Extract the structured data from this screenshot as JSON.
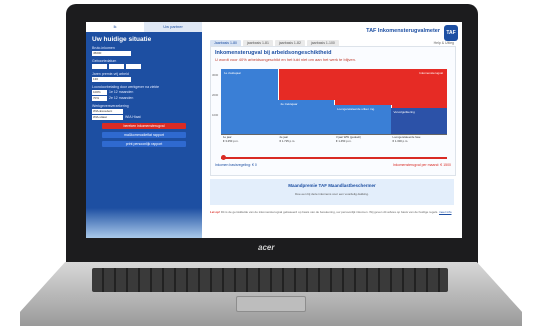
{
  "laptop": {
    "brand": "acer"
  },
  "left_panel": {
    "tabs": [
      "Ik",
      "Uw partner"
    ],
    "heading": "Uw huidige situatie",
    "fields": [
      {
        "label": "Bruto-inkomen",
        "value": "45000"
      },
      {
        "label": "Geboortedatum",
        "value": ""
      },
      {
        "label": "Jaren premie-vrij arbeid",
        "value": "130"
      },
      {
        "label": "Loondoorbetaling door werkgever na ziekte",
        "value": "100%"
      },
      {
        "label": "",
        "value": "70%"
      },
      {
        "label": "Werkgeversverzekering",
        "value": "WIA-Excedent"
      },
      {
        "label": "",
        "value": "WIA-Hiaat"
      }
    ],
    "year_labels": [
      "1e 12 maanden",
      "2e 12 maanden"
    ],
    "wia_label": "WIA Hiaat",
    "buttons": {
      "calculate": "bereken inkomensterugval",
      "report": "maßkommodieflat rapport",
      "pdf": "print persoonlijk rapport"
    }
  },
  "header": {
    "title": "TAF Inkomensterugvalmeter",
    "logo": "TAF",
    "tabs": [
      "Jaarbasis 1-80",
      "jaarbasis 1-81",
      "jaarbasis 1-82",
      "jaarbasis 1-100"
    ],
    "right_link": "Help & Uitleg"
  },
  "chart_data": {
    "type": "bar",
    "title": "Inkomensterugval bij arbeidsongeschiktheid",
    "subtitle": "U wordt voor 40% arbeidsongeschikt en het lukt niet om aan het werk te blijven.",
    "categories": [
      "1e jaar",
      "2e jaar",
      "3 jaar WW (gedeelt)",
      "Loongerelateerde fase"
    ],
    "values": [
      3250,
      1725,
      1450,
      1300
    ],
    "tick_text": [
      "€ 3.250 p.m.",
      "€ 1.725 p.m.",
      "€ 1.450 p.m.",
      "€ 1.300 p.m."
    ],
    "bar_labels": [
      "1e ziektejaar",
      "2e ziektejaar",
      "Loongerelateerde uitker. ing.",
      "Vervolguitkering"
    ],
    "ylim": [
      0,
      3500
    ],
    "yticks": [
      "1000",
      "2000",
      "3000"
    ],
    "legend": "Inkomensterugval",
    "slider_left": "Inkomen basisregeling: € 0",
    "slider_right": "Inkomensterugval per maand: € 1500",
    "colors": {
      "income": "#3a7fd6",
      "gap": "#e62b25",
      "after": "#2c52a8"
    }
  },
  "promo": {
    "title": "Maandpremie TAF Maandlastbeschermer",
    "text": "Doe een bij deze inkomens voor een voordelig dekking."
  },
  "footer": {
    "label": "Let op!",
    "text": "Dit is de gemiddelde van de inkomensterugval gebaseerd op basis van de berekening, uw persoonlijk inkomen. Wij geven dit advies op basis van de huidige regels.",
    "link": "meer info"
  }
}
